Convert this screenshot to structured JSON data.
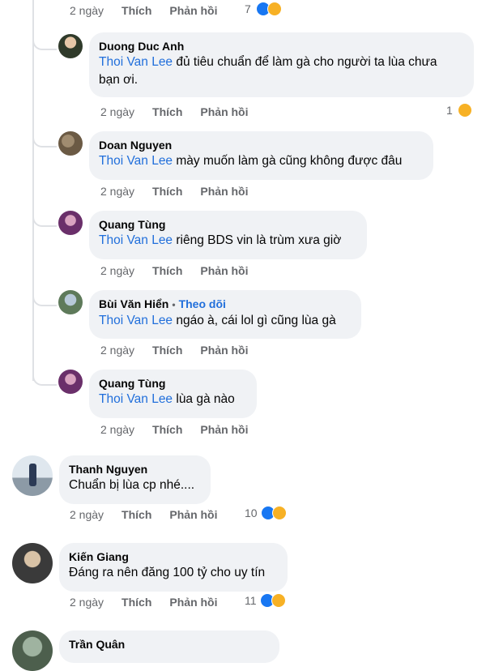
{
  "actions": {
    "time": "2 ngày",
    "like": "Thích",
    "reply": "Phản hồi"
  },
  "top_row": {
    "count": "7"
  },
  "replies": [
    {
      "author": "Duong Duc Anh",
      "mention": "Thoi Van Lee",
      "text_line1": " đủ tiêu chuẩn để làm gà cho người ta lùa chưa",
      "text_line2": "bạn ơi.",
      "reaction_count": "1"
    },
    {
      "author": "Doan Nguyen",
      "mention": "Thoi Van Lee",
      "text": " mày muốn làm gà cũng không được đâu"
    },
    {
      "author": "Quang Tùng",
      "mention": "Thoi Van Lee",
      "text": " riêng BDS vin là trùm xưa giờ"
    },
    {
      "author": "Bùi Văn Hiển",
      "follow": "Theo dõi",
      "mention": "Thoi Van Lee",
      "text": " ngáo à, cái lol gì cũng lùa gà"
    },
    {
      "author": "Quang Tùng",
      "mention": "Thoi Van Lee",
      "text": " lùa gà nào"
    }
  ],
  "comments": [
    {
      "author": "Thanh Nguyen",
      "text": "Chuẩn bị lùa cp nhé....",
      "reaction_count": "10"
    },
    {
      "author": "Kiến Giang",
      "text": "Đáng ra nên đăng 100 tỷ cho uy tín",
      "reaction_count": "11"
    },
    {
      "author": "Trần Quân"
    }
  ]
}
